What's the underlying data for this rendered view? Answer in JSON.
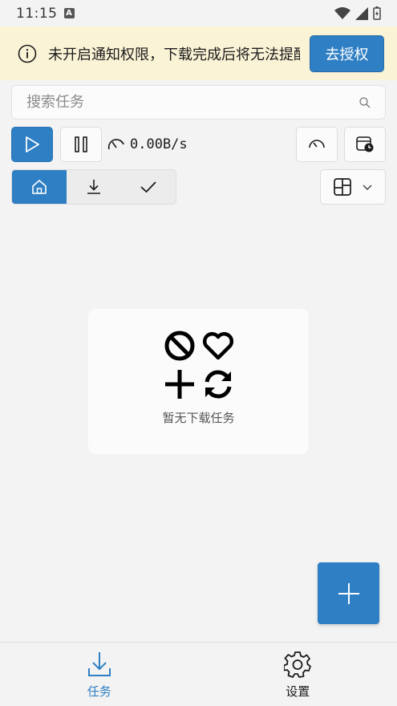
{
  "status_bar": {
    "time": "11:15",
    "notification_badge": "A"
  },
  "banner": {
    "message": "未开启通知权限，下载完成后将无法提醒",
    "button_label": "去授权"
  },
  "search": {
    "placeholder": "搜索任务",
    "value": ""
  },
  "toolbar": {
    "speed": "0.00B/s"
  },
  "empty_state": {
    "text": "暂无下载任务"
  },
  "bottom_nav": {
    "items": [
      {
        "label": "任务",
        "icon": "download-icon",
        "active": true
      },
      {
        "label": "设置",
        "icon": "gear-icon",
        "active": false
      }
    ]
  },
  "colors": {
    "accent": "#2f7fc4",
    "banner_bg": "#fbf3d6",
    "page_bg": "#f3f3f3"
  }
}
